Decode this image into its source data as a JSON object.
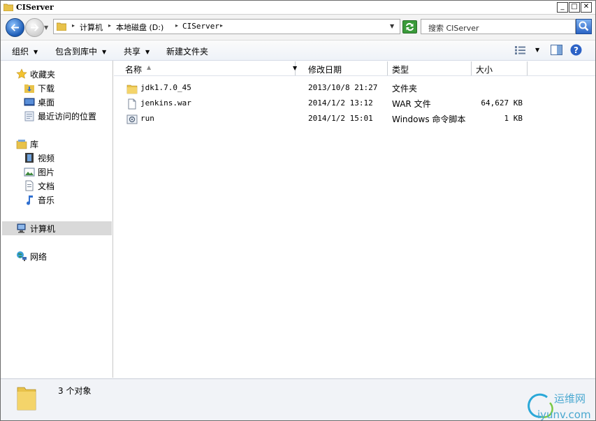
{
  "window": {
    "title": "CIServer"
  },
  "address": {
    "crumbs": [
      "计算机",
      "本地磁盘 (D:)",
      "CIServer"
    ]
  },
  "search": {
    "placeholder": "搜索 CIServer"
  },
  "toolbar": {
    "organize": "组织",
    "include_library": "包含到库中",
    "share": "共享",
    "new_folder": "新建文件夹"
  },
  "sidebar": {
    "favorites": "收藏夹",
    "fav_items": [
      "下载",
      "桌面",
      "最近访问的位置"
    ],
    "libraries": "库",
    "lib_items": [
      "视频",
      "图片",
      "文档",
      "音乐"
    ],
    "computer": "计算机",
    "network": "网络"
  },
  "columns": {
    "name": "名称",
    "date": "修改日期",
    "type": "类型",
    "size": "大小"
  },
  "files": [
    {
      "name": "jdk1.7.0_45",
      "date": "2013/10/8 21:27",
      "type": "文件夹",
      "size": "",
      "icon": "folder-icon"
    },
    {
      "name": "jenkins.war",
      "date": "2014/1/2 13:12",
      "type": "WAR 文件",
      "size": "64,627 KB",
      "icon": "file-icon"
    },
    {
      "name": "run",
      "date": "2014/1/2 15:01",
      "type": "Windows 命令脚本",
      "size": "1 KB",
      "icon": "script-icon"
    }
  ],
  "status": {
    "count_text": "3 个对象"
  },
  "watermark": {
    "cn": "运维网",
    "url": "iyunv.com"
  }
}
